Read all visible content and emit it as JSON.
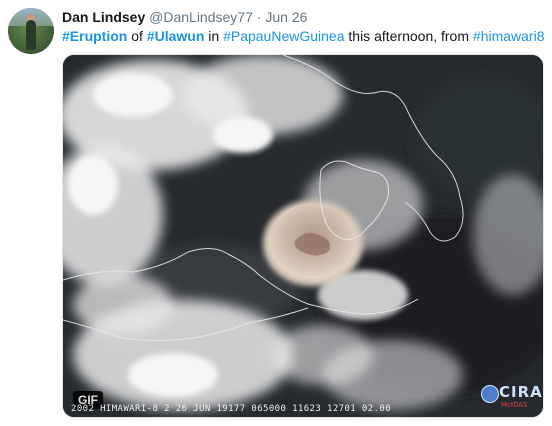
{
  "tweet": {
    "author_name": "Dan Lindsey",
    "author_handle": "@DanLindsey77",
    "separator": "·",
    "date": "Jun 26",
    "text": {
      "tag1": "#Eruption",
      "word1": " of ",
      "tag2": "#Ulawun",
      "word2": " in ",
      "tag3": "#PapauNewGuinea",
      "word3": " this afternoon, from ",
      "tag4": "#himawari8"
    },
    "media": {
      "badge": "GIF",
      "caption": "2002 HIMAWARI-8  2 26 JUN 19177 065000 11623 12701 02.00",
      "logo_text": "CIRA",
      "logo_sub": "McIDAS"
    }
  },
  "colors": {
    "link": "#1b95e0",
    "text": "#14171a",
    "muted": "#657786"
  }
}
